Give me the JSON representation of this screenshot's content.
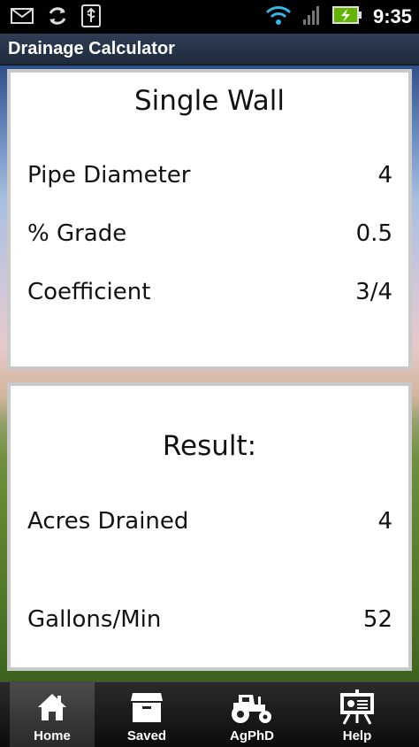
{
  "status_bar": {
    "time": "9:35",
    "icons": [
      "gmail-icon",
      "sync-icon",
      "usb-icon",
      "wifi-icon",
      "signal-icon",
      "battery-charging-icon"
    ]
  },
  "app": {
    "title": "Drainage Calculator"
  },
  "input_card": {
    "title": "Single Wall",
    "rows": [
      {
        "label": "Pipe Diameter",
        "value": "4"
      },
      {
        "label": "% Grade",
        "value": "0.5"
      },
      {
        "label": "Coefficient",
        "value": "3/4"
      }
    ]
  },
  "result_card": {
    "title": "Result:",
    "rows": [
      {
        "label": "Acres Drained",
        "value": "4"
      },
      {
        "label": "Gallons/Min",
        "value": "52"
      }
    ]
  },
  "bottom_nav": {
    "items": [
      {
        "label": "Home",
        "icon": "home-icon",
        "active": true
      },
      {
        "label": "Saved",
        "icon": "saved-box-icon",
        "active": false
      },
      {
        "label": "AgPhD",
        "icon": "tractor-icon",
        "active": false
      },
      {
        "label": "Help",
        "icon": "help-presentation-icon",
        "active": false
      }
    ]
  },
  "colors": {
    "title_bar": "#2e3d55",
    "card_bg": "#ffffff",
    "card_border": "#c9c9c9",
    "nav_bg": "#1a1a1a"
  }
}
